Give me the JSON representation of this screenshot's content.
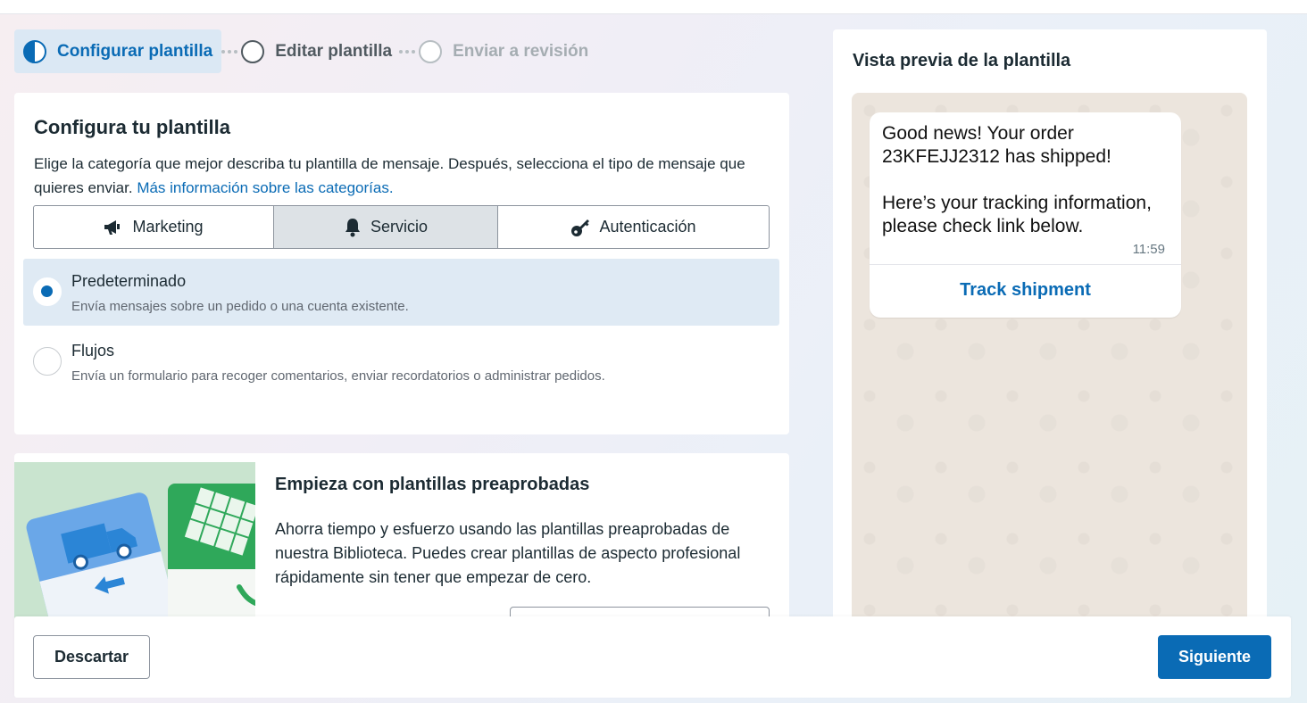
{
  "stepper": {
    "steps": [
      {
        "label": "Configurar plantilla",
        "state": "active"
      },
      {
        "label": "Editar plantilla",
        "state": "pending"
      },
      {
        "label": "Enviar a revisión",
        "state": "disabled"
      }
    ]
  },
  "setup": {
    "title": "Configura tu plantilla",
    "description": "Elige la categoría que mejor describa tu plantilla de mensaje. Después, selecciona el tipo de mensaje que quieres enviar.",
    "learn_more_link": "Más información sobre las categorías.",
    "categories": [
      {
        "label": "Marketing",
        "icon": "megaphone-icon",
        "selected": false
      },
      {
        "label": "Servicio",
        "icon": "bell-icon",
        "selected": true
      },
      {
        "label": "Autenticación",
        "icon": "key-icon",
        "selected": false
      }
    ],
    "types": [
      {
        "title": "Predeterminado",
        "subtitle": "Envía mensajes sobre un pedido o una cuenta existente.",
        "selected": true
      },
      {
        "title": "Flujos",
        "subtitle": "Envía un formulario para recoger comentarios, enviar recordatorios o administrar pedidos.",
        "selected": false
      }
    ]
  },
  "preapproved": {
    "title": "Empieza con plantillas preaprobadas",
    "body": "Ahorra tiempo y esfuerzo usando las plantillas preaprobadas de nuestra Biblioteca. Puedes crear plantillas de aspecto profesional rápidamente sin tener que empezar de cero."
  },
  "preview": {
    "title": "Vista previa de la plantilla",
    "message": "Good news! Your order 23KFEJJ2312 has shipped!\n\nHere’s your tracking information, please check link below.",
    "time": "11:59",
    "button": "Track shipment"
  },
  "footer": {
    "discard": "Descartar",
    "next": "Siguiente"
  },
  "colors": {
    "accent": "#0a6bb5",
    "selected_bg": "#dfeaf4",
    "chat_bg": "#ece5dd"
  }
}
